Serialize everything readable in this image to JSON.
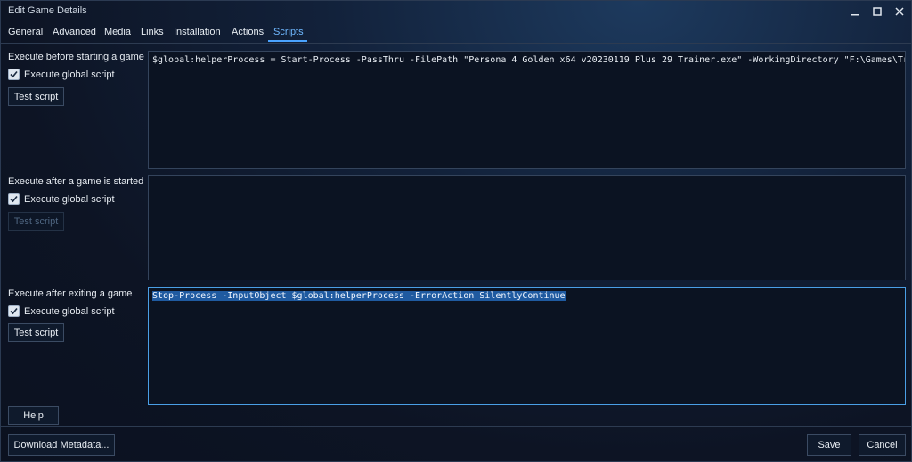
{
  "window": {
    "title": "Edit Game Details",
    "controls": [
      "minimize-icon",
      "maximize-icon",
      "close-icon"
    ]
  },
  "tabs": [
    {
      "label": "General",
      "active": false
    },
    {
      "label": "Advanced",
      "active": false
    },
    {
      "label": "Media",
      "active": false
    },
    {
      "label": "Links",
      "active": false
    },
    {
      "label": "Installation",
      "active": false
    },
    {
      "label": "Actions",
      "active": false
    },
    {
      "label": "Scripts",
      "active": true
    }
  ],
  "sections": [
    {
      "label": "Execute before starting a game",
      "checkbox_label": "Execute global script",
      "checked": true,
      "test_button": "Test script",
      "test_enabled": true,
      "script": "$global:helperProcess = Start-Process -PassThru -FilePath \"Persona 4 Golden x64 v20230119 Plus 29 Trainer.exe\" -WorkingDirectory \"F:\\Games\\Trainers\""
    },
    {
      "label": "Execute after a game is started",
      "checkbox_label": "Execute global script",
      "checked": true,
      "test_button": "Test script",
      "test_enabled": false,
      "script": ""
    },
    {
      "label": "Execute after exiting a game",
      "checkbox_label": "Execute global script",
      "checked": true,
      "test_button": "Test script",
      "test_enabled": true,
      "script": "Stop-Process -InputObject $global:helperProcess -ErrorAction SilentlyContinue"
    }
  ],
  "buttons": {
    "help": "Help",
    "download_metadata": "Download Metadata...",
    "save": "Save",
    "cancel": "Cancel"
  },
  "colors": {
    "accent": "#4aa3ff",
    "selection": "#1f5aa0",
    "background": "#0e1526"
  }
}
